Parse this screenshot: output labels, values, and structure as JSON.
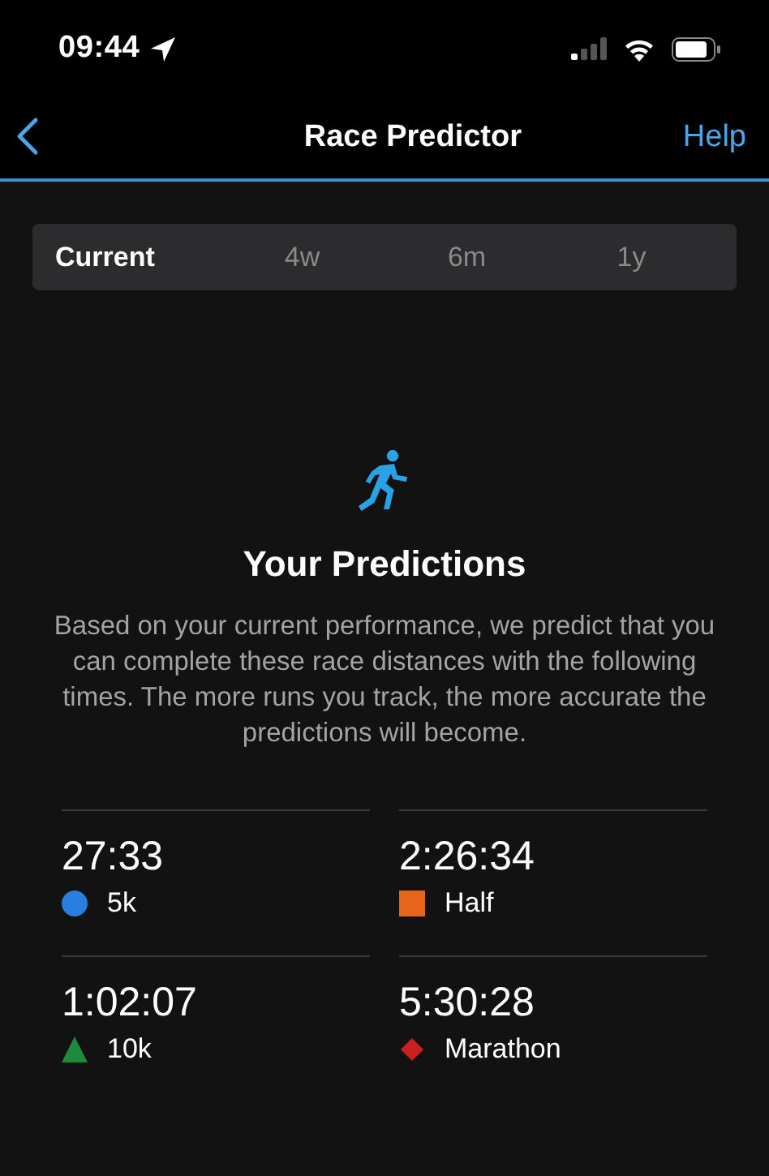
{
  "status_bar": {
    "time": "09:44"
  },
  "nav": {
    "title": "Race Predictor",
    "action": "Help"
  },
  "tabs": [
    {
      "label": "Current",
      "selected": true
    },
    {
      "label": "4w",
      "selected": false
    },
    {
      "label": "6m",
      "selected": false
    },
    {
      "label": "1y",
      "selected": false
    }
  ],
  "intro": {
    "title": "Your Predictions",
    "text": "Based on your current performance, we predict that you can complete these race distances with the following times. The more runs you track, the more accurate the predictions will become."
  },
  "predictions": [
    {
      "time": "27:33",
      "label": "5k",
      "kind": "circle",
      "color": "#2a7de1"
    },
    {
      "time": "2:26:34",
      "label": "Half",
      "kind": "square",
      "color": "#e8641b"
    },
    {
      "time": "1:02:07",
      "label": "10k",
      "kind": "triangle",
      "color": "#1e8a3c"
    },
    {
      "time": "5:30:28",
      "label": "Marathon",
      "kind": "diamond",
      "color": "#cc1f1f"
    }
  ]
}
